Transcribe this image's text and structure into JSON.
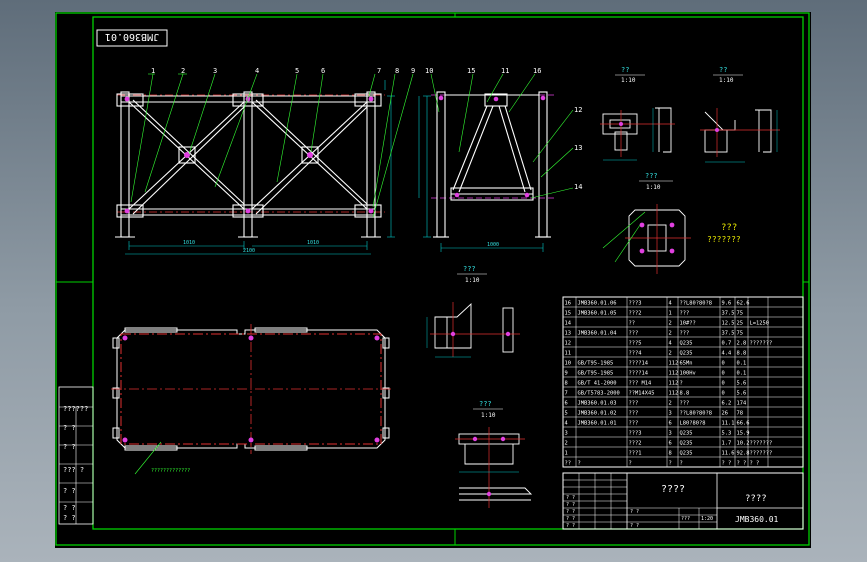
{
  "colors": {
    "background": "#000000",
    "frame": "#00d000",
    "geometry": "#ffffff",
    "dimension": "#00c8c8",
    "centerline": "#e03030",
    "hidden": "#e040e0",
    "leader": "#33ff33"
  },
  "drawing_number_stamp": "JMB360.01",
  "balloons": [
    "1",
    "2",
    "3",
    "4",
    "5",
    "6",
    "7",
    "8",
    "9",
    "10",
    "15",
    "11",
    "16",
    "12",
    "13",
    "14"
  ],
  "views": {
    "detail_a": {
      "title": "??",
      "scale": "1:10"
    },
    "detail_b": {
      "title": "??",
      "scale": "1:10"
    },
    "detail_c": {
      "title": "???",
      "scale": "1:10"
    },
    "detail_d": {
      "title": "???",
      "scale": "1:10"
    },
    "detail_e": {
      "title": "???",
      "scale": "1:10"
    },
    "note": {
      "title": "???",
      "text": "???????"
    }
  },
  "plan_view_note": "?????????????",
  "left_block_labels": [
    "??????",
    "? ?",
    "? ?",
    "??? ?",
    "? ?",
    "? ?",
    "? ?"
  ],
  "bom": {
    "rows": [
      [
        "16",
        "JMB360.01.06",
        "???3",
        "4",
        "??L80?80?8",
        "9.6",
        "62.6"
      ],
      [
        "15",
        "JMB360.01.05",
        "???2",
        "1",
        "???",
        "37.5",
        "75"
      ],
      [
        "14",
        "",
        "??",
        "2",
        "10#??",
        "12.5",
        "25",
        "L=1250"
      ],
      [
        "13",
        "JMB360.01.04",
        "???",
        "2",
        "???",
        "37.5",
        "75"
      ],
      [
        "12",
        "",
        "???5",
        "4",
        "Q235",
        "0.7",
        "2.8",
        "???????"
      ],
      [
        "11",
        "",
        "???4",
        "2",
        "Q235",
        "4.4",
        "8.8"
      ],
      [
        "10",
        "GB/T95-1985",
        "????14",
        "112",
        "65Mn",
        "0",
        "0.1"
      ],
      [
        "9",
        "GB/T95-1985",
        "????14",
        "112",
        "100Hv",
        "0",
        "0.1"
      ],
      [
        "8",
        "GB/T 41-2000",
        "??? M14",
        "112",
        "?",
        "0",
        "5.6"
      ],
      [
        "7",
        "GB/T5783-2000",
        "??M14X45",
        "112",
        "8.8",
        "0",
        "5.6"
      ],
      [
        "6",
        "JMB360.01.03",
        "???",
        "2",
        "???",
        "6.2",
        "174"
      ],
      [
        "5",
        "JMB360.01.02",
        "???",
        "3",
        "??L80?80?8",
        "26",
        "78"
      ],
      [
        "4",
        "JMB360.01.01",
        "???",
        "6",
        "L80?80?8",
        "11.1",
        "66.6"
      ],
      [
        "3",
        "",
        "???3",
        "3",
        "Q235",
        "5.3",
        "15.9"
      ],
      [
        "2",
        "",
        "???2",
        "6",
        "Q235",
        "1.7",
        "10.2",
        "???????"
      ],
      [
        "1",
        "",
        "???1",
        "8",
        "Q235",
        "11.6",
        "92.8",
        "???????"
      ],
      [
        "??",
        "?",
        "?",
        "?",
        "?",
        "? ?",
        "? ?",
        "? ?"
      ]
    ],
    "title_name": "????",
    "company": "????",
    "drawing_no": "JMB360.01",
    "weight": "???",
    "scale": "1:20",
    "sign_cells": [
      "? ?",
      "? ?",
      "? ?",
      "? ?",
      "? ?",
      "? ?",
      "? ?"
    ]
  }
}
